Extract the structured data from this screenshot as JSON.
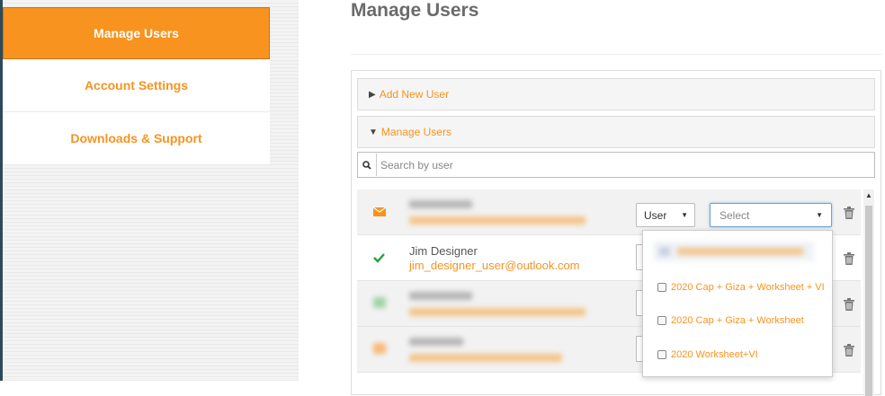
{
  "sidebar": {
    "items": [
      {
        "label": "Manage Users"
      },
      {
        "label": "Account Settings"
      },
      {
        "label": "Downloads & Support"
      }
    ]
  },
  "main": {
    "title": "Manage Users",
    "accordion": {
      "add_new_user": "Add New User",
      "manage_users": "Manage Users"
    },
    "search": {
      "placeholder": "Search by user"
    },
    "users": [
      {
        "name": "",
        "email": "",
        "status": "pending-mail-icon",
        "role": "User",
        "plan": "Select"
      },
      {
        "name": "Jim  Designer",
        "email": "jim_designer_user@outlook.com",
        "status": "check-icon"
      },
      {
        "name": "",
        "email": "",
        "status": "blurred"
      },
      {
        "name": "",
        "email": "",
        "status": "blurred"
      }
    ],
    "plan_options": [
      {
        "label": "2020 Cap + Giza + Worksheet + VI"
      },
      {
        "label": "2020 Cap + Giza + Worksheet"
      },
      {
        "label": "2020 Worksheet+VI"
      }
    ]
  },
  "colors": {
    "accent": "#f7931e",
    "text": "#555555",
    "focus": "#6fa1d3"
  }
}
